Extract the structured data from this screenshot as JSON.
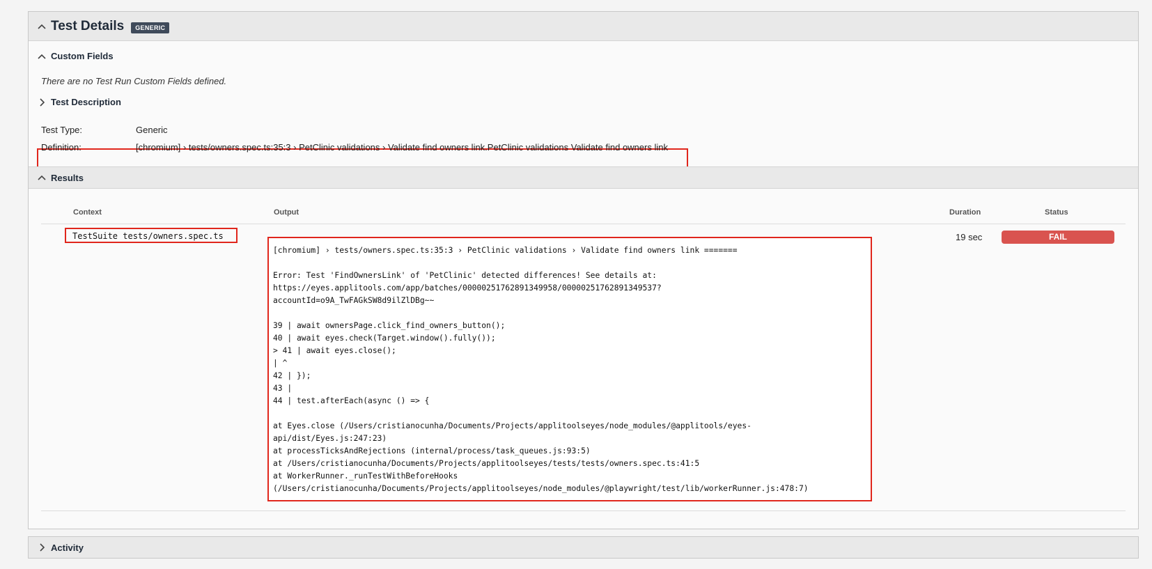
{
  "test_details": {
    "title": "Test Details",
    "badge": "GENERIC"
  },
  "custom_fields": {
    "title": "Custom Fields",
    "empty_message": "There are no Test Run Custom Fields defined."
  },
  "test_description": {
    "title": "Test Description"
  },
  "test_info": {
    "type_label": "Test Type:",
    "type_value": "Generic",
    "definition_label": "Definition:",
    "definition_value": "[chromium] › tests/owners.spec.ts:35:3 › PetClinic validations › Validate find owners link.PetClinic validations Validate find owners link"
  },
  "results": {
    "title": "Results",
    "columns": {
      "context": "Context",
      "output": "Output",
      "duration": "Duration",
      "status": "Status"
    },
    "row": {
      "context": "TestSuite tests/owners.spec.ts",
      "output": "[chromium] › tests/owners.spec.ts:35:3 › PetClinic validations › Validate find owners link =======\n\nError: Test 'FindOwnersLink' of 'PetClinic' detected differences! See details at:\nhttps://eyes.applitools.com/app/batches/00000251762891349958/00000251762891349537?\naccountId=o9A_TwFAGkSW8d9ilZlDBg~~\n\n39 | await ownersPage.click_find_owners_button();\n40 | await eyes.check(Target.window().fully());\n> 41 | await eyes.close();\n| ^\n42 | });\n43 |\n44 | test.afterEach(async () => {\n\nat Eyes.close (/Users/cristianocunha/Documents/Projects/applitoolseyes/node_modules/@applitools/eyes-\napi/dist/Eyes.js:247:23)\nat processTicksAndRejections (internal/process/task_queues.js:93:5)\nat /Users/cristianocunha/Documents/Projects/applitoolseyes/tests/tests/owners.spec.ts:41:5\nat WorkerRunner._runTestWithBeforeHooks\n(/Users/cristianocunha/Documents/Projects/applitoolseyes/node_modules/@playwright/test/lib/workerRunner.js:478:7)",
      "duration": "19 sec",
      "status": "FAIL"
    }
  },
  "activity": {
    "title": "Activity"
  },
  "colors": {
    "highlight": "#e0261c",
    "fail": "#d9534f",
    "badge": "#3f4a5a",
    "header_bg": "#e9e9e9"
  },
  "icons": {
    "expanded": "chevron-up-icon",
    "collapsed": "chevron-right-icon"
  }
}
